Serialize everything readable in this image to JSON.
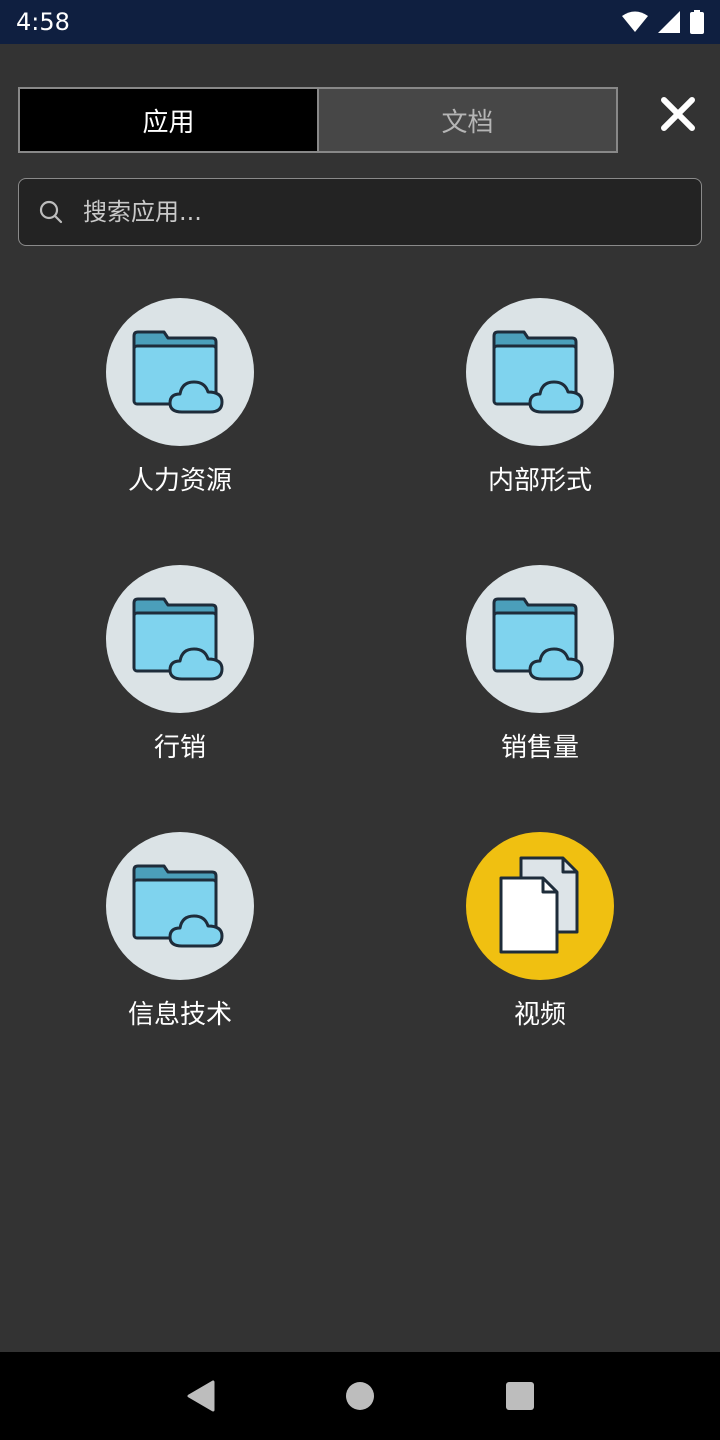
{
  "status": {
    "time": "4:58"
  },
  "tabs": [
    {
      "label": "应用",
      "active": true
    },
    {
      "label": "文档",
      "active": false
    }
  ],
  "search": {
    "placeholder": "搜索应用..."
  },
  "apps": [
    {
      "label": "人力资源",
      "icon": "folder-cloud-icon"
    },
    {
      "label": "内部形式",
      "icon": "folder-cloud-icon"
    },
    {
      "label": "行销",
      "icon": "folder-cloud-icon"
    },
    {
      "label": "销售量",
      "icon": "folder-cloud-icon"
    },
    {
      "label": "信息技术",
      "icon": "folder-cloud-icon"
    },
    {
      "label": "视频",
      "icon": "documents-icon"
    }
  ],
  "colors": {
    "background": "#333333",
    "status_bar": "#0f1f40",
    "app_circle": "#dbe3e6",
    "video_circle": "#f0c011",
    "folder_fill": "#7fd3ee"
  }
}
